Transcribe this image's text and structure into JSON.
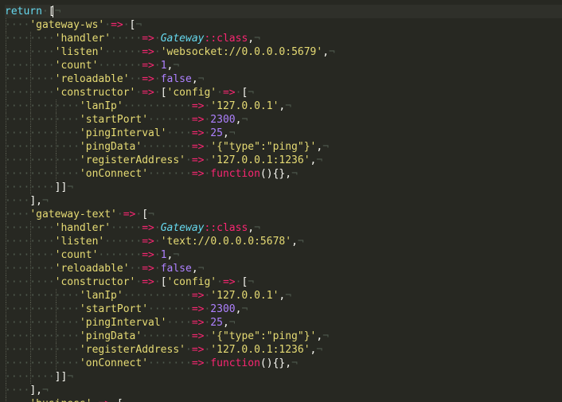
{
  "editor": {
    "lines": [
      {
        "indent": 0,
        "current": true,
        "tokens": [
          [
            "return",
            "kw"
          ],
          [
            "·",
            "ws"
          ],
          [
            "[",
            "punc"
          ]
        ]
      },
      {
        "indent": 1,
        "tokens": [
          [
            "'gateway-ws'",
            "str"
          ],
          [
            "·",
            "ws"
          ],
          [
            "=>",
            "op"
          ],
          [
            "·",
            "ws"
          ],
          [
            "[",
            "punc"
          ]
        ]
      },
      {
        "indent": 2,
        "tokens": [
          [
            "'handler'",
            "str"
          ],
          [
            "·····",
            "ws"
          ],
          [
            "=>",
            "op"
          ],
          [
            "·",
            "ws"
          ],
          [
            "Gateway",
            "class"
          ],
          [
            "::",
            "op"
          ],
          [
            "class",
            "fn"
          ],
          [
            ",",
            "punc"
          ]
        ]
      },
      {
        "indent": 2,
        "tokens": [
          [
            "'listen'",
            "str"
          ],
          [
            "······",
            "ws"
          ],
          [
            "=>",
            "op"
          ],
          [
            "·",
            "ws"
          ],
          [
            "'websocket://0.0.0.0:5679'",
            "str"
          ],
          [
            ",",
            "punc"
          ]
        ]
      },
      {
        "indent": 2,
        "tokens": [
          [
            "'count'",
            "str"
          ],
          [
            "·······",
            "ws"
          ],
          [
            "=>",
            "op"
          ],
          [
            "·",
            "ws"
          ],
          [
            "1",
            "num"
          ],
          [
            ",",
            "punc"
          ]
        ]
      },
      {
        "indent": 2,
        "tokens": [
          [
            "'reloadable'",
            "str"
          ],
          [
            "··",
            "ws"
          ],
          [
            "=>",
            "op"
          ],
          [
            "·",
            "ws"
          ],
          [
            "false",
            "num"
          ],
          [
            ",",
            "punc"
          ]
        ]
      },
      {
        "indent": 2,
        "tokens": [
          [
            "'constructor'",
            "str"
          ],
          [
            "·",
            "ws"
          ],
          [
            "=>",
            "op"
          ],
          [
            "·",
            "ws"
          ],
          [
            "[",
            "punc"
          ],
          [
            "'config'",
            "str"
          ],
          [
            "·",
            "ws"
          ],
          [
            "=>",
            "op"
          ],
          [
            "·",
            "ws"
          ],
          [
            "[",
            "punc"
          ]
        ]
      },
      {
        "indent": 3,
        "tokens": [
          [
            "'lanIp'",
            "str"
          ],
          [
            "···········",
            "ws"
          ],
          [
            "=>",
            "op"
          ],
          [
            "·",
            "ws"
          ],
          [
            "'127.0.0.1'",
            "str"
          ],
          [
            ",",
            "punc"
          ]
        ]
      },
      {
        "indent": 3,
        "tokens": [
          [
            "'startPort'",
            "str"
          ],
          [
            "·······",
            "ws"
          ],
          [
            "=>",
            "op"
          ],
          [
            "·",
            "ws"
          ],
          [
            "2300",
            "num"
          ],
          [
            ",",
            "punc"
          ]
        ]
      },
      {
        "indent": 3,
        "tokens": [
          [
            "'pingInterval'",
            "str"
          ],
          [
            "····",
            "ws"
          ],
          [
            "=>",
            "op"
          ],
          [
            "·",
            "ws"
          ],
          [
            "25",
            "num"
          ],
          [
            ",",
            "punc"
          ]
        ]
      },
      {
        "indent": 3,
        "tokens": [
          [
            "'pingData'",
            "str"
          ],
          [
            "········",
            "ws"
          ],
          [
            "=>",
            "op"
          ],
          [
            "·",
            "ws"
          ],
          [
            "'{\"type\":\"ping\"}'",
            "str"
          ],
          [
            ",",
            "punc"
          ]
        ]
      },
      {
        "indent": 3,
        "tokens": [
          [
            "'registerAddress'",
            "str"
          ],
          [
            "·",
            "ws"
          ],
          [
            "=>",
            "op"
          ],
          [
            "·",
            "ws"
          ],
          [
            "'127.0.0.1:1236'",
            "str"
          ],
          [
            ",",
            "punc"
          ]
        ]
      },
      {
        "indent": 3,
        "tokens": [
          [
            "'onConnect'",
            "str"
          ],
          [
            "·······",
            "ws"
          ],
          [
            "=>",
            "op"
          ],
          [
            "·",
            "ws"
          ],
          [
            "function",
            "fn"
          ],
          [
            "(){}",
            "punc"
          ],
          [
            ",",
            "punc"
          ]
        ]
      },
      {
        "indent": 2,
        "tokens": [
          [
            "]]",
            "punc"
          ]
        ]
      },
      {
        "indent": 1,
        "tokens": [
          [
            "],",
            "punc"
          ]
        ]
      },
      {
        "indent": 1,
        "tokens": [
          [
            "'gateway-text'",
            "str"
          ],
          [
            "·",
            "ws"
          ],
          [
            "=>",
            "op"
          ],
          [
            "·",
            "ws"
          ],
          [
            "[",
            "punc"
          ]
        ]
      },
      {
        "indent": 2,
        "tokens": [
          [
            "'handler'",
            "str"
          ],
          [
            "·····",
            "ws"
          ],
          [
            "=>",
            "op"
          ],
          [
            "·",
            "ws"
          ],
          [
            "Gateway",
            "class"
          ],
          [
            "::",
            "op"
          ],
          [
            "class",
            "fn"
          ],
          [
            ",",
            "punc"
          ]
        ]
      },
      {
        "indent": 2,
        "tokens": [
          [
            "'listen'",
            "str"
          ],
          [
            "······",
            "ws"
          ],
          [
            "=>",
            "op"
          ],
          [
            "·",
            "ws"
          ],
          [
            "'text://0.0.0.0:5678'",
            "str"
          ],
          [
            ",",
            "punc"
          ]
        ]
      },
      {
        "indent": 2,
        "tokens": [
          [
            "'count'",
            "str"
          ],
          [
            "·······",
            "ws"
          ],
          [
            "=>",
            "op"
          ],
          [
            "·",
            "ws"
          ],
          [
            "1",
            "num"
          ],
          [
            ",",
            "punc"
          ]
        ]
      },
      {
        "indent": 2,
        "tokens": [
          [
            "'reloadable'",
            "str"
          ],
          [
            "··",
            "ws"
          ],
          [
            "=>",
            "op"
          ],
          [
            "·",
            "ws"
          ],
          [
            "false",
            "num"
          ],
          [
            ",",
            "punc"
          ]
        ]
      },
      {
        "indent": 2,
        "tokens": [
          [
            "'constructor'",
            "str"
          ],
          [
            "·",
            "ws"
          ],
          [
            "=>",
            "op"
          ],
          [
            "·",
            "ws"
          ],
          [
            "[",
            "punc"
          ],
          [
            "'config'",
            "str"
          ],
          [
            "·",
            "ws"
          ],
          [
            "=>",
            "op"
          ],
          [
            "·",
            "ws"
          ],
          [
            "[",
            "punc"
          ]
        ]
      },
      {
        "indent": 3,
        "tokens": [
          [
            "'lanIp'",
            "str"
          ],
          [
            "···········",
            "ws"
          ],
          [
            "=>",
            "op"
          ],
          [
            "·",
            "ws"
          ],
          [
            "'127.0.0.1'",
            "str"
          ],
          [
            ",",
            "punc"
          ]
        ]
      },
      {
        "indent": 3,
        "tokens": [
          [
            "'startPort'",
            "str"
          ],
          [
            "·······",
            "ws"
          ],
          [
            "=>",
            "op"
          ],
          [
            "·",
            "ws"
          ],
          [
            "2300",
            "num"
          ],
          [
            ",",
            "punc"
          ]
        ]
      },
      {
        "indent": 3,
        "tokens": [
          [
            "'pingInterval'",
            "str"
          ],
          [
            "····",
            "ws"
          ],
          [
            "=>",
            "op"
          ],
          [
            "·",
            "ws"
          ],
          [
            "25",
            "num"
          ],
          [
            ",",
            "punc"
          ]
        ]
      },
      {
        "indent": 3,
        "tokens": [
          [
            "'pingData'",
            "str"
          ],
          [
            "········",
            "ws"
          ],
          [
            "=>",
            "op"
          ],
          [
            "·",
            "ws"
          ],
          [
            "'{\"type\":\"ping\"}'",
            "str"
          ],
          [
            ",",
            "punc"
          ]
        ]
      },
      {
        "indent": 3,
        "tokens": [
          [
            "'registerAddress'",
            "str"
          ],
          [
            "·",
            "ws"
          ],
          [
            "=>",
            "op"
          ],
          [
            "·",
            "ws"
          ],
          [
            "'127.0.0.1:1236'",
            "str"
          ],
          [
            ",",
            "punc"
          ]
        ]
      },
      {
        "indent": 3,
        "tokens": [
          [
            "'onConnect'",
            "str"
          ],
          [
            "·······",
            "ws"
          ],
          [
            "=>",
            "op"
          ],
          [
            "·",
            "ws"
          ],
          [
            "function",
            "fn"
          ],
          [
            "(){}",
            "punc"
          ],
          [
            ",",
            "punc"
          ]
        ]
      },
      {
        "indent": 2,
        "tokens": [
          [
            "]]",
            "punc"
          ]
        ]
      },
      {
        "indent": 1,
        "tokens": [
          [
            "],",
            "punc"
          ]
        ]
      },
      {
        "indent": 1,
        "tokens": [
          [
            "'business'",
            "str"
          ],
          [
            "·",
            "ws"
          ],
          [
            "=>",
            "op"
          ],
          [
            "·",
            "ws"
          ],
          [
            "[",
            "punc"
          ]
        ]
      }
    ]
  }
}
